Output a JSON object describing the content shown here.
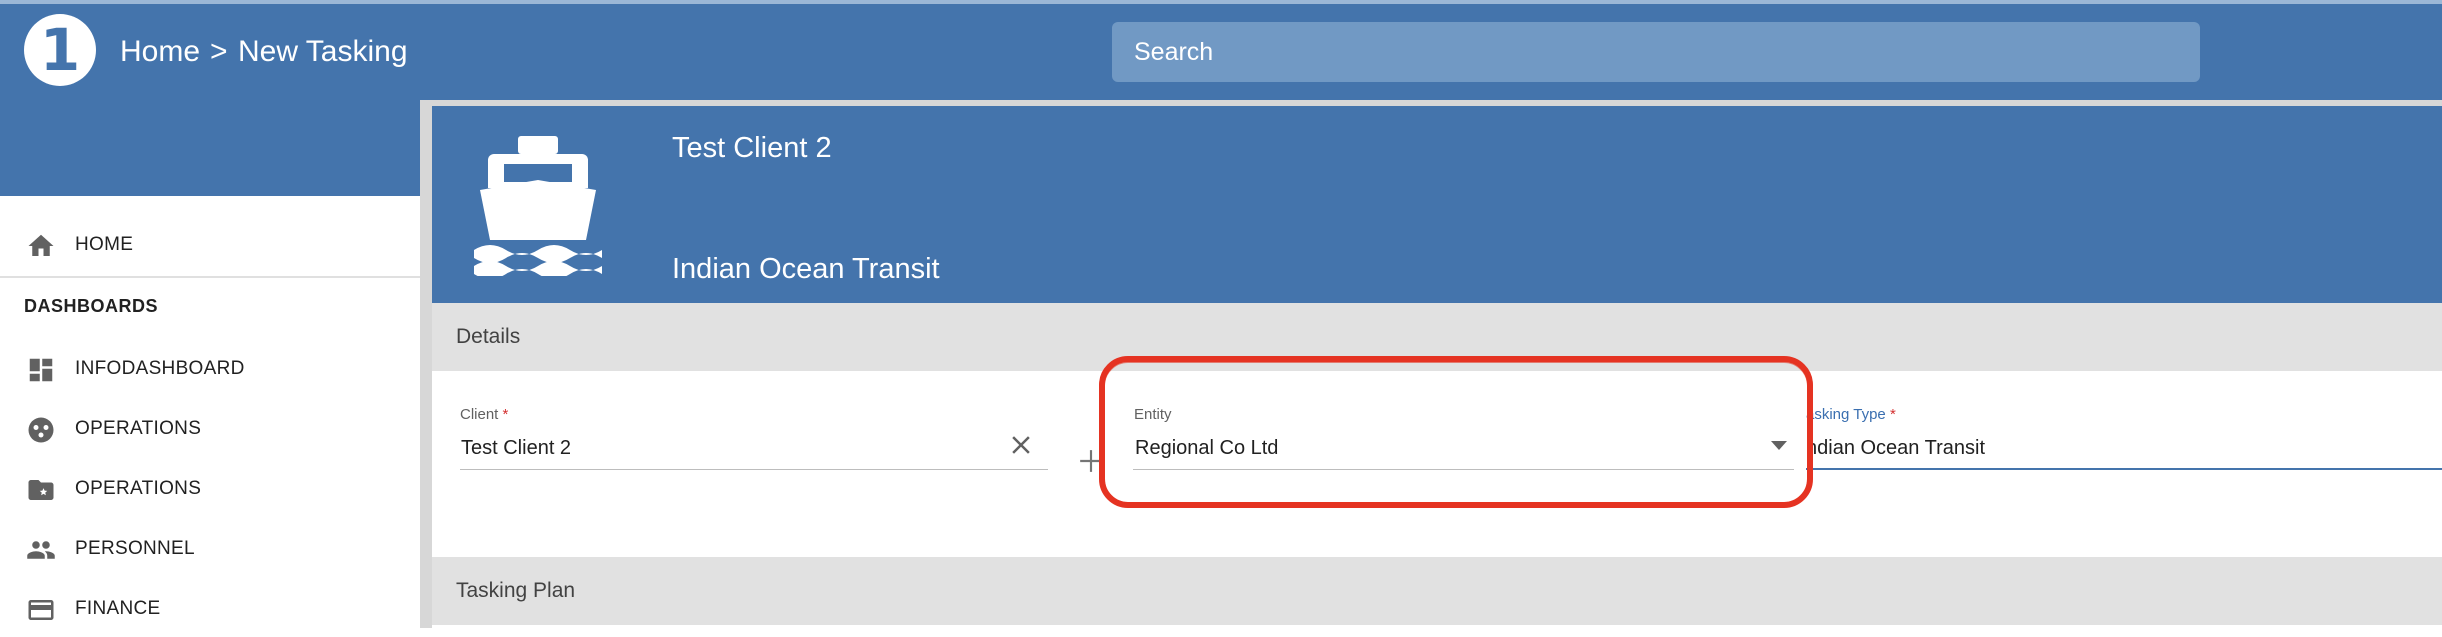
{
  "header": {
    "logo_text": "1",
    "breadcrumb": {
      "home": "Home",
      "separator": ">",
      "current": "New Tasking"
    },
    "search": {
      "placeholder": "Search",
      "value": ""
    }
  },
  "sidebar": {
    "items_top": [
      {
        "label": "HOME",
        "icon": "home-icon"
      }
    ],
    "section_title": "DASHBOARDS",
    "items": [
      {
        "label": "INFODASHBOARD",
        "icon": "dashboard-icon"
      },
      {
        "label": "OPERATIONS",
        "icon": "operations-icon"
      },
      {
        "label": "OPERATIONS",
        "icon": "folder-star-icon"
      },
      {
        "label": "PERSONNEL",
        "icon": "people-icon"
      },
      {
        "label": "FINANCE",
        "icon": "credit-card-icon"
      }
    ]
  },
  "card": {
    "icon": "ship-icon",
    "client_name": "Test Client 2",
    "tasking_name": "Indian Ocean Transit"
  },
  "details": {
    "section_title": "Details",
    "client": {
      "label": "Client",
      "required_mark": "*",
      "value": "Test Client 2"
    },
    "entity": {
      "label": "Entity",
      "value": "Regional Co Ltd"
    },
    "tasking_type": {
      "label": "Tasking Type",
      "label_visible": "asking Type",
      "required_mark": "*",
      "value": "Indian Ocean Transit",
      "value_visible": "ndian Ocean Transit"
    }
  },
  "plan": {
    "section_title": "Tasking Plan"
  },
  "colors": {
    "primary": "#4474ac",
    "search_bg": "#7199c4",
    "section_bg": "#e1e1e1",
    "highlight": "#e53322",
    "required": "#d32f2f"
  }
}
